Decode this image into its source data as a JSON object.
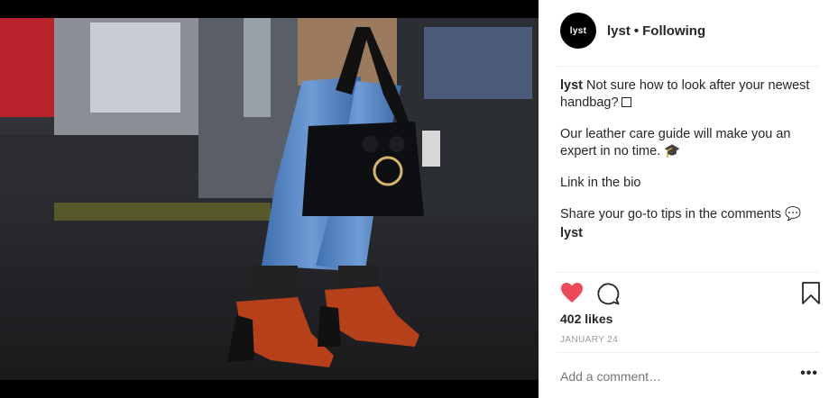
{
  "post": {
    "image": "street style photo of red heeled shoes with fishnet socks, cropped jeans and a black leather handbag",
    "account": {
      "username": "lyst",
      "avatar_text": "lyst",
      "separator": "•",
      "follow_status": "Following"
    },
    "caption": {
      "username": "lyst",
      "line1": "Not sure how to look after your newest handbag?",
      "para2": "Our leather care guide will make you an expert in no time. 🎓",
      "para3": "Link in the bio",
      "para4": "Share your go-to tips in the comments 💬",
      "tag": "lyst"
    },
    "likes": "402 likes",
    "date": "JANUARY 24",
    "comment_placeholder": "Add a comment…",
    "more_label": "•••",
    "liked": true,
    "colors": {
      "heart": "#ed4956",
      "text": "#262626",
      "muted": "#999999"
    },
    "icons": [
      "heart-icon",
      "comment-icon",
      "bookmark-icon",
      "more-options-icon"
    ]
  }
}
